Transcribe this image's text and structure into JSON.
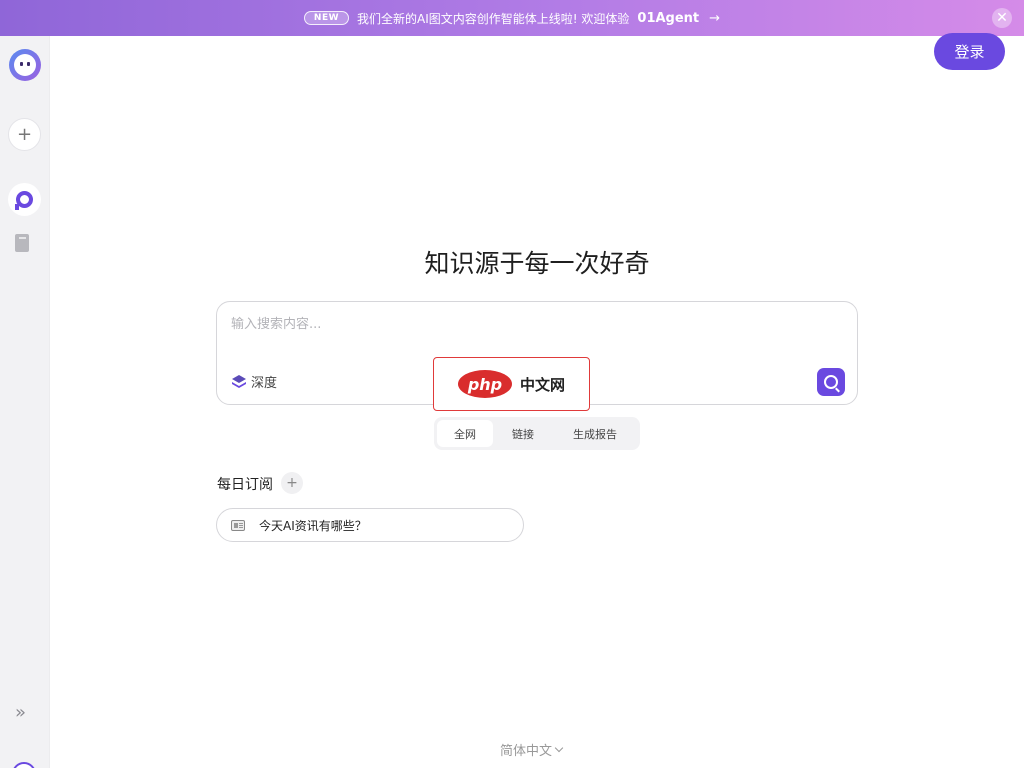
{
  "banner": {
    "badge": "NEW",
    "text": "我们全新的AI图文内容创作智能体上线啦! 欢迎体验",
    "link": "01Agent",
    "arrow": "→",
    "close_icon": "close-icon"
  },
  "sidebar": {
    "logo_icon": "app-logo",
    "new_chat_icon": "plus-icon",
    "nav_items": [
      {
        "icon": "search-icon",
        "active": true
      },
      {
        "icon": "book-icon",
        "active": false
      }
    ],
    "expand_icon": "double-chevron-right-icon",
    "expand_glyph": "»"
  },
  "header": {
    "login_label": "登录"
  },
  "main": {
    "headline": "知识源于每一次好奇",
    "search": {
      "placeholder": "输入搜索内容...",
      "value": "",
      "deep_label": "深度",
      "send_icon": "search-icon"
    },
    "scope_tabs": [
      {
        "label": "全网",
        "active": true
      },
      {
        "label": "链接",
        "active": false
      },
      {
        "label": "生成报告",
        "active": false
      }
    ],
    "daily": {
      "title": "每日订阅",
      "add_icon": "plus-icon",
      "items": [
        {
          "label": "今天AI资讯有哪些？",
          "icon": "newspaper-icon"
        }
      ]
    }
  },
  "watermark": {
    "logo_text": "php",
    "text": "中文网"
  },
  "footer": {
    "language": "简体中文"
  },
  "colors": {
    "accent": "#6a49e0",
    "banner_start": "#8f66d8",
    "banner_end": "#d58be8",
    "sidebar_bg": "#f2f2f4"
  }
}
